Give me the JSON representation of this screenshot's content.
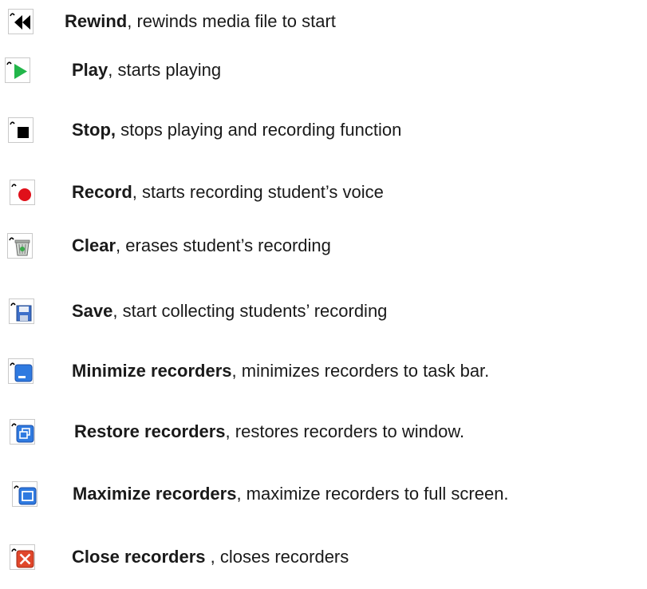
{
  "items": [
    {
      "term": "Rewind",
      "desc": ", rewinds media file to start"
    },
    {
      "term": "Play",
      "desc": ", starts playing"
    },
    {
      "term": "Stop,",
      "desc": " stops playing and recording function"
    },
    {
      "term": "Record",
      "desc": ", starts recording student’s voice"
    },
    {
      "term": "Clear",
      "desc": ", erases student’s recording"
    },
    {
      "term": "Save",
      "desc": ", start collecting students’ recording"
    },
    {
      "term": "Minimize recorders",
      "desc": ", minimizes recorders to task bar."
    },
    {
      "term": "Restore recorders",
      "desc": ", restores recorders to window."
    },
    {
      "term": "Maximize recorders",
      "desc": ", maximize recorders to full screen."
    },
    {
      "term": "Close recorders",
      "desc": " , closes recorders"
    }
  ],
  "icons": [
    "rewind-icon",
    "play-icon",
    "stop-icon",
    "record-icon",
    "clear-icon",
    "save-icon",
    "minimize-icon",
    "restore-icon",
    "maximize-icon",
    "close-icon"
  ]
}
